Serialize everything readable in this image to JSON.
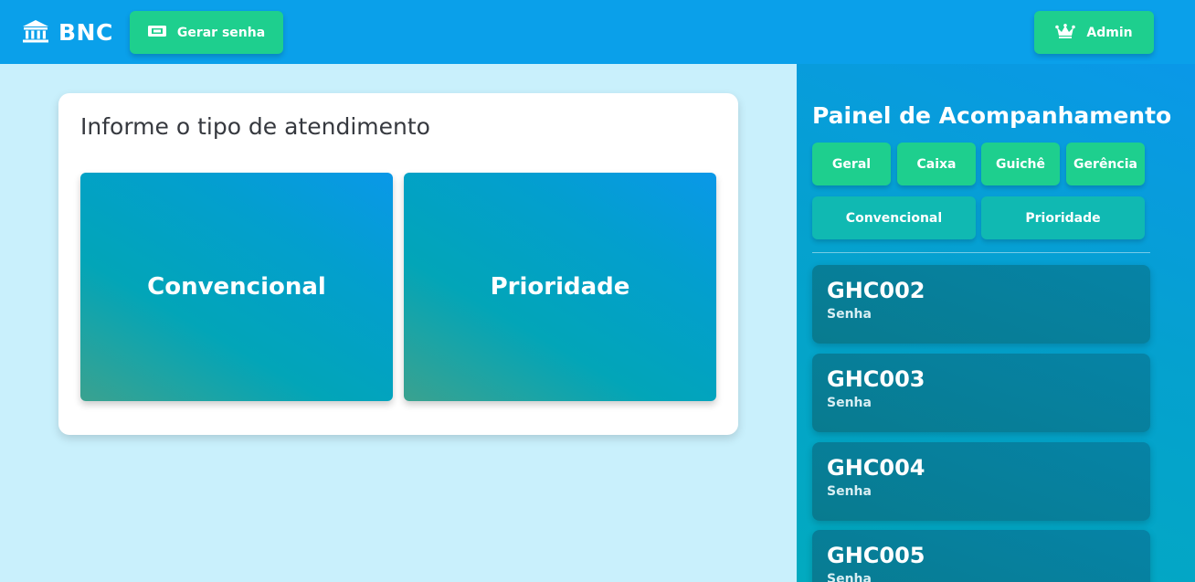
{
  "header": {
    "brand_name": "BNC",
    "brand_icon": "bank-icon",
    "gerar_label": "Gerar senha",
    "gerar_icon": "ticket-icon",
    "admin_label": "Admin",
    "admin_icon": "crown-icon",
    "color": "#0aa0ea"
  },
  "main": {
    "title": "Informe o tipo de atendimento",
    "options": [
      "Convencional",
      "Prioridade"
    ]
  },
  "panel": {
    "title": "Painel de Acompanhamento",
    "filters_row1": [
      "Geral",
      "Caixa",
      "Guichê",
      "Gerência"
    ],
    "filters_row2": [
      "Convencional",
      "Prioridade"
    ],
    "tickets": [
      {
        "code": "GHC002",
        "label": "Senha"
      },
      {
        "code": "GHC003",
        "label": "Senha"
      },
      {
        "code": "GHC004",
        "label": "Senha"
      },
      {
        "code": "GHC005",
        "label": "Senha"
      }
    ]
  },
  "colors": {
    "accent_green": "#1ecf8e",
    "teal_button": "#10b9b2",
    "page_bg": "#c9f0fc"
  }
}
